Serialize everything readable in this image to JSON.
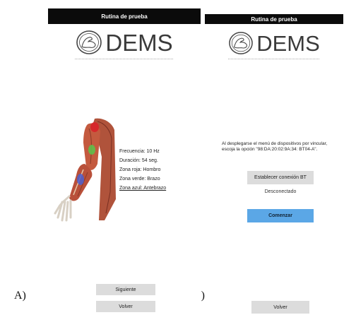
{
  "labels": {
    "a": "A)",
    "b": "B)"
  },
  "screen_a": {
    "title": "Rutina de prueba",
    "logo": "DEMS",
    "logo_icon": "flexed-arm-circle-icon",
    "illustration": "arm-muscle-anatomy",
    "info": {
      "frecuencia": "Frecuencia: 10 Hz",
      "duracion": "Duración: 54 seg.",
      "zona_roja": "Zona roja: Hombro",
      "zona_verde": "Zona verde: Brazo",
      "zona_azul": "Zona azul: Antebrazo"
    },
    "zone_colors": {
      "roja": "#d7262a",
      "verde": "#5fbf4a",
      "azul": "#4b5fd0"
    },
    "buttons": {
      "siguiente": "Siguiente",
      "volver": "Volver"
    }
  },
  "screen_b": {
    "title": "Rutina de prueba",
    "logo": "DEMS",
    "logo_icon": "flexed-arm-circle-icon",
    "message": "Al desplegarse el menú de dispositivos por vincular, escoja la opción \"98:DA:20:02:9A:34: BT04-A\".",
    "buttons": {
      "conexion": "Establecer conexión BT",
      "comenzar": "Comenzar",
      "volver": "Volver"
    },
    "status": "Desconectado",
    "accent": "#5ba7e6"
  }
}
